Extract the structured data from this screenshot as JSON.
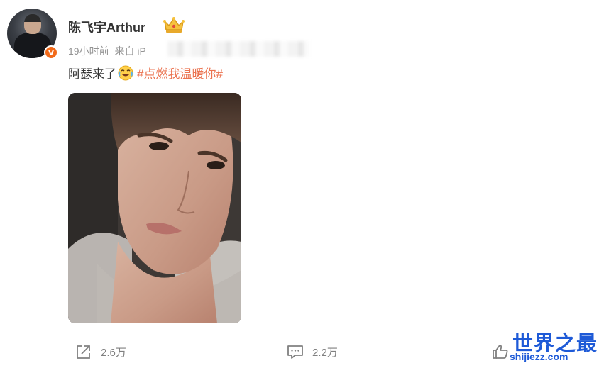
{
  "post": {
    "username": "陈飞宇Arthur",
    "time": "19小时前",
    "source_prefix": "来自 iP",
    "text": "阿瑟来了",
    "hashtag": "#点燃我温暖你#"
  },
  "actions": {
    "share_count": "2.6万",
    "comment_count": "2.2万"
  },
  "watermark": {
    "title": "世界之最",
    "url": "shijiezz.com"
  },
  "colors": {
    "hashtag": "#eb7350",
    "verified_badge": "#f26a19",
    "watermark": "#1e5ad7"
  },
  "icons": {
    "verified": "verified-v-icon",
    "member": "crown-icon",
    "emoji": "laughing-tears-emoji",
    "share": "share-icon",
    "comment": "comment-icon",
    "like": "thumbs-up-icon"
  }
}
